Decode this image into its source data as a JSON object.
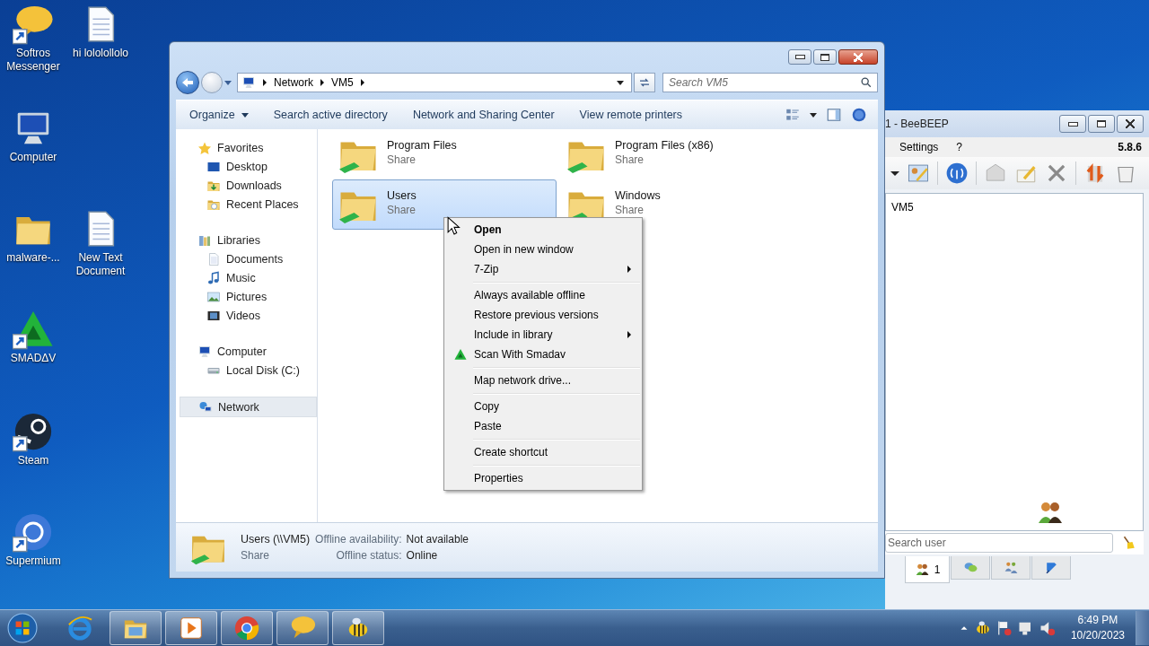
{
  "desktop_icons": [
    {
      "label": "Softros Messenger",
      "kind": "bubble",
      "shortcut": true
    },
    {
      "label": "hi lololollolo",
      "kind": "doc",
      "shortcut": false
    },
    {
      "label": "Computer",
      "kind": "computer",
      "shortcut": false
    },
    {
      "label": "malware-...",
      "kind": "folder",
      "shortcut": false
    },
    {
      "label": "New Text Document",
      "kind": "doc",
      "shortcut": false
    },
    {
      "label": "SMADΔV",
      "kind": "smadav",
      "shortcut": true
    },
    {
      "label": "Steam",
      "kind": "steam",
      "shortcut": true
    },
    {
      "label": "Supermium",
      "kind": "ring",
      "shortcut": true
    }
  ],
  "explorer": {
    "address": {
      "crumbs": [
        "Network",
        "VM5"
      ],
      "search_placeholder": "Search VM5"
    },
    "toolbar": [
      "Organize",
      "Search active directory",
      "Network and Sharing Center",
      "View remote printers"
    ],
    "navigation": [
      {
        "label": "Favorites",
        "kind": "star",
        "selected": false,
        "children": [
          {
            "label": "Desktop",
            "kind": "desktop",
            "selected": false
          },
          {
            "label": "Downloads",
            "kind": "downloads",
            "selected": false
          },
          {
            "label": "Recent Places",
            "kind": "recent",
            "selected": false
          }
        ]
      },
      {
        "label": "Libraries",
        "kind": "library",
        "selected": false,
        "children": [
          {
            "label": "Documents",
            "kind": "doc",
            "selected": false
          },
          {
            "label": "Music",
            "kind": "music",
            "selected": false
          },
          {
            "label": "Pictures",
            "kind": "pictures",
            "selected": false
          },
          {
            "label": "Videos",
            "kind": "videos",
            "selected": false
          }
        ]
      },
      {
        "label": "Computer",
        "kind": "computer",
        "selected": false,
        "children": [
          {
            "label": "Local Disk (C:)",
            "kind": "disk",
            "selected": false
          }
        ]
      },
      {
        "label": "Network",
        "kind": "network",
        "selected": true
      }
    ],
    "items": [
      {
        "name": "Program Files",
        "type": "Share",
        "selected": false
      },
      {
        "name": "Program Files (x86)",
        "type": "Share",
        "selected": false
      },
      {
        "name": "Users",
        "type": "Share",
        "selected": true
      },
      {
        "name": "Windows",
        "type": "Share",
        "selected": false
      }
    ],
    "details": {
      "name": "Users (\\\\VM5)",
      "type": "Share",
      "properties": [
        {
          "label": "Offline availability:",
          "value": "Not available"
        },
        {
          "label": "Offline status:",
          "value": "Online"
        }
      ]
    }
  },
  "context_menu": [
    [
      {
        "label": "Open",
        "default": true,
        "submenu": false,
        "has_icon": false
      },
      {
        "label": "Open in new window",
        "default": false,
        "submenu": false,
        "has_icon": false
      },
      {
        "label": "7-Zip",
        "default": false,
        "submenu": true,
        "has_icon": false
      }
    ],
    [
      {
        "label": "Always available offline",
        "default": false,
        "submenu": false,
        "has_icon": false
      },
      {
        "label": "Restore previous versions",
        "default": false,
        "submenu": false,
        "has_icon": false
      },
      {
        "label": "Include in library",
        "default": false,
        "submenu": true,
        "has_icon": false
      },
      {
        "label": "Scan With Smadav",
        "default": false,
        "submenu": false,
        "has_icon": true
      }
    ],
    [
      {
        "label": "Map network drive...",
        "default": false,
        "submenu": false,
        "has_icon": false
      }
    ],
    [
      {
        "label": "Copy",
        "default": false,
        "submenu": false,
        "has_icon": false
      },
      {
        "label": "Paste",
        "default": false,
        "submenu": false,
        "has_icon": false
      }
    ],
    [
      {
        "label": "Create shortcut",
        "default": false,
        "submenu": false,
        "has_icon": false
      }
    ],
    [
      {
        "label": "Properties",
        "default": false,
        "submenu": false,
        "has_icon": false
      }
    ]
  ],
  "beebeep": {
    "title": "1 - BeeBEEP",
    "menu": [
      "Settings",
      "?"
    ],
    "version": "5.8.6",
    "users": [
      "VM5"
    ],
    "search_placeholder": "Search user",
    "tabs": [
      {
        "label": "1",
        "kind": "people",
        "selected": true
      },
      {
        "kind": "chat",
        "selected": false
      },
      {
        "kind": "groups",
        "selected": false
      },
      {
        "kind": "share",
        "selected": false
      }
    ]
  },
  "taskbar": {
    "apps": [
      {
        "kind": "ie",
        "running": false
      },
      {
        "kind": "explorer",
        "running": true
      },
      {
        "kind": "media",
        "running": true
      },
      {
        "kind": "chrome",
        "running": true
      },
      {
        "kind": "bubble",
        "running": true
      },
      {
        "kind": "bee",
        "running": true
      }
    ],
    "time": "6:49 PM",
    "date": "10/20/2023"
  }
}
